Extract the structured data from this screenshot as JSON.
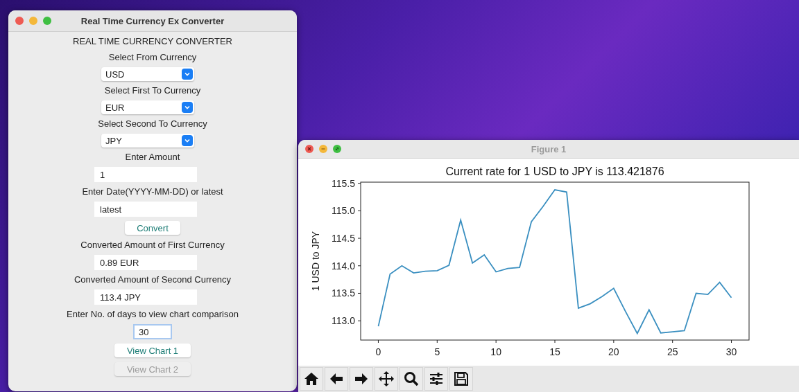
{
  "converter_window": {
    "title": "Real Time Currency Ex Converter",
    "items": [
      {
        "kind": "label",
        "text": "REAL TIME CURRENCY CONVERTER"
      },
      {
        "kind": "label",
        "text": "Select From Currency"
      },
      {
        "kind": "select",
        "value": "USD"
      },
      {
        "kind": "label",
        "text": "Select First To Currency"
      },
      {
        "kind": "select",
        "value": "EUR"
      },
      {
        "kind": "label",
        "text": "Select Second To Currency"
      },
      {
        "kind": "select",
        "value": "JPY"
      },
      {
        "kind": "label",
        "text": "Enter Amount"
      },
      {
        "kind": "input",
        "value": "1",
        "focused": false
      },
      {
        "kind": "label",
        "text": "Enter Date(YYYY-MM-DD) or latest"
      },
      {
        "kind": "input",
        "value": "latest",
        "focused": false
      },
      {
        "kind": "button",
        "text": "Convert",
        "disabled": false
      },
      {
        "kind": "label",
        "text": "Converted Amount of First Currency"
      },
      {
        "kind": "input",
        "value": "0.89 EUR",
        "focused": false
      },
      {
        "kind": "label",
        "text": "Converted Amount of Second Currency"
      },
      {
        "kind": "input",
        "value": "113.4 JPY",
        "focused": false
      },
      {
        "kind": "label",
        "text": "Enter No. of days to view chart comparison"
      },
      {
        "kind": "small-input",
        "value": "30",
        "focused": true
      },
      {
        "kind": "button",
        "text": "View Chart 1",
        "disabled": false
      },
      {
        "kind": "button",
        "text": "View Chart 2",
        "disabled": true
      }
    ]
  },
  "figure_window": {
    "title": "Figure 1",
    "chart_data": {
      "type": "line",
      "title": "Current rate for 1 USD to JPY is 113.421876",
      "ylabel": "1 USD to JPY",
      "x": [
        0,
        1,
        2,
        3,
        4,
        5,
        6,
        7,
        8,
        9,
        10,
        11,
        12,
        13,
        14,
        15,
        16,
        17,
        18,
        19,
        20,
        21,
        22,
        23,
        24,
        25,
        26,
        27,
        28,
        29,
        30
      ],
      "series": [
        {
          "color": "#3a8fc0",
          "values": [
            112.9,
            113.85,
            114.0,
            113.87,
            113.9,
            113.91,
            114.01,
            114.83,
            114.05,
            114.2,
            113.89,
            113.95,
            113.97,
            114.8,
            115.08,
            115.38,
            115.34,
            113.23,
            113.31,
            113.44,
            113.59,
            113.17,
            112.77,
            113.2,
            112.78,
            112.8,
            112.82,
            113.5,
            113.48,
            113.7,
            113.42
          ]
        }
      ],
      "xlim": [
        -1.5,
        31.5
      ],
      "ylim": [
        112.65,
        115.52
      ],
      "xticks": [
        0,
        5,
        10,
        15,
        20,
        25,
        30
      ],
      "yticks": [
        {
          "value": 113,
          "label": "113.0"
        },
        {
          "value": 113.5,
          "label": "113.5"
        },
        {
          "value": 114,
          "label": "114.0"
        },
        {
          "value": 114.5,
          "label": "114.5"
        },
        {
          "value": 115,
          "label": "115.0"
        },
        {
          "value": 115.5,
          "label": "115.5"
        }
      ]
    },
    "toolbar": [
      {
        "kind": "home"
      },
      {
        "kind": "back"
      },
      {
        "kind": "forward"
      },
      {
        "kind": "pan"
      },
      {
        "kind": "zoom"
      },
      {
        "kind": "configure"
      },
      {
        "kind": "save"
      }
    ]
  }
}
